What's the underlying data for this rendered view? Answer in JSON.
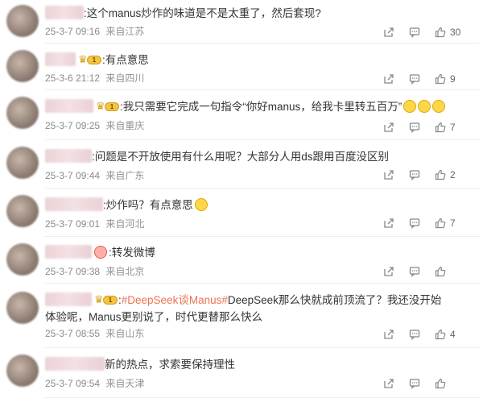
{
  "comments": [
    {
      "text": ":这个manus炒作的味道是不是太重了，然后套现?",
      "time": "25-3-7 09:16",
      "location": "来自江苏",
      "likes": "30"
    },
    {
      "badge_level": "1",
      "text": ":有点意思",
      "time": "25-3-6 21:12",
      "location": "来自四川",
      "likes": "9"
    },
    {
      "badge_level": "1",
      "text": ":我只需要它完成一句指令“你好manus，给我卡里转五百万”",
      "time": "25-3-7 09:25",
      "location": "来自重庆",
      "likes": "7"
    },
    {
      "text": ":问题是不开放使用有什么用呢？大部分人用ds跟用百度没区别",
      "time": "25-3-7 09:44",
      "location": "来自广东",
      "likes": "2"
    },
    {
      "text": ":炒作吗？有点意思",
      "time": "25-3-7 09:01",
      "location": "来自河北",
      "likes": "7"
    },
    {
      "text": ":转发微博",
      "time": "25-3-7 09:38",
      "location": "来自北京",
      "likes": ""
    },
    {
      "badge_level": "1",
      "text_hashtag": "#DeepSeek谈Manus#",
      "text_prefix": ":",
      "text": "DeepSeek那么快就成前顶流了？我还没开始体验呢，Manus更别说了，时代更替那么快么",
      "time": "25-3-7 08:55",
      "location": "来自山东",
      "likes": "4"
    },
    {
      "text": "新的热点，求索要保持理性",
      "time": "25-3-7 09:54",
      "location": "来自天津",
      "likes": ""
    }
  ],
  "icons": {
    "share": "share-icon",
    "reply": "comment-icon",
    "like": "thumbs-up-icon",
    "crown": "crown-icon"
  },
  "colors": {
    "hashtag": "#eb7350",
    "meta": "#939393",
    "badge": "#f5c542"
  }
}
